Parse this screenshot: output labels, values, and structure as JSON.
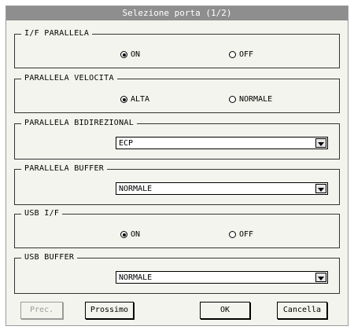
{
  "title": "Selezione porta (1/2)",
  "groups": {
    "if_parallela": {
      "label": "I/F PARALLELA",
      "options": [
        "ON",
        "OFF"
      ],
      "selected": "ON"
    },
    "parallela_velocita": {
      "label": "PARALLELA VELOCITA",
      "options": [
        "ALTA",
        "NORMALE"
      ],
      "selected": "ALTA"
    },
    "parallela_bidirezional": {
      "label": "PARALLELA BIDIREZIONAL",
      "value": "ECP"
    },
    "parallela_buffer": {
      "label": "PARALLELA BUFFER",
      "value": "NORMALE"
    },
    "usb_if": {
      "label": "USB I/F",
      "options": [
        "ON",
        "OFF"
      ],
      "selected": "ON"
    },
    "usb_buffer": {
      "label": "USB BUFFER",
      "value": "NORMALE"
    }
  },
  "buttons": {
    "prev": "Prec.",
    "next": "Prossimo",
    "ok": "OK",
    "cancel": "Cancella"
  },
  "icons": {
    "dropdown": "chevron-down-icon",
    "radio": "radio-icon"
  },
  "colors": {
    "titlebar": "#8e8e8e",
    "background": "#f4f4ee"
  }
}
